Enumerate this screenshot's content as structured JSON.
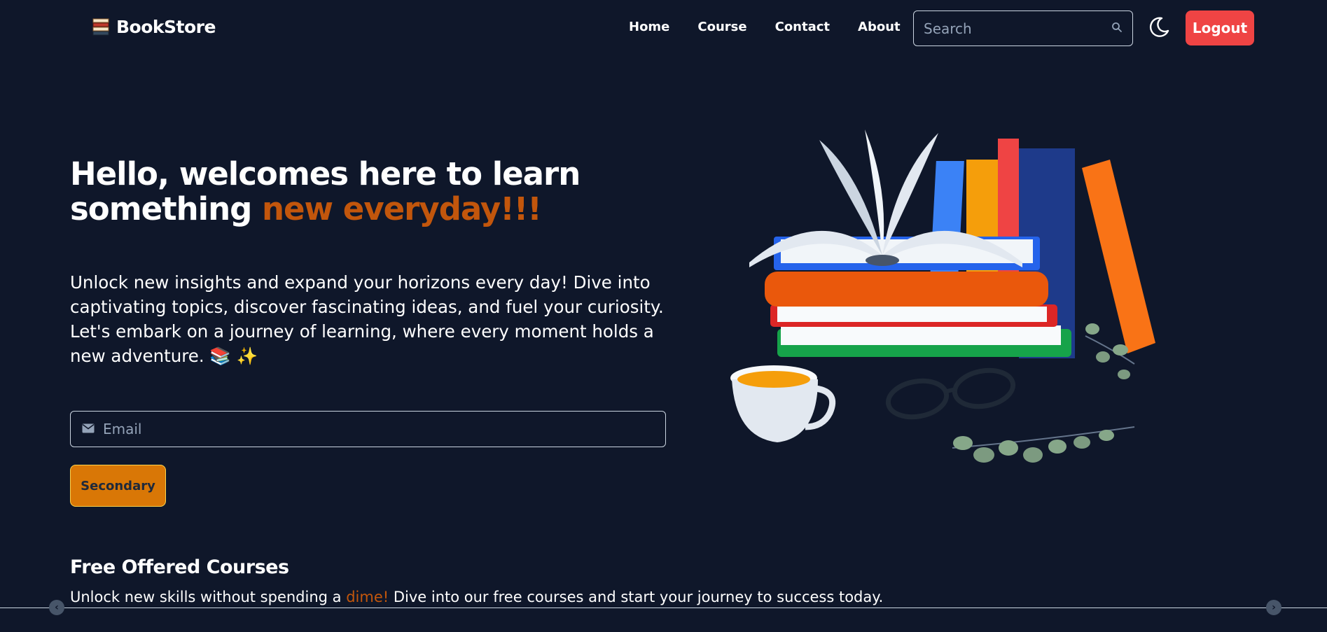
{
  "brand": {
    "name": "BookStore",
    "icon": "books-stack-icon"
  },
  "nav": {
    "links": [
      "Home",
      "Course",
      "Contact",
      "About"
    ],
    "search_placeholder": "Search",
    "search_icon": "search-icon",
    "theme_icon": "moon-icon",
    "logout_label": "Logout"
  },
  "hero": {
    "title_main": "Hello, welcomes here to learn something ",
    "title_accent": "new everyday!!!",
    "description": "Unlock new insights and expand your horizons every day! Dive into captivating topics, discover fascinating ideas, and fuel your curiosity. Let's embark on a journey of learning, where every moment holds a new adventure. 📚 ✨",
    "email_placeholder": "Email",
    "email_icon": "envelope-icon",
    "button_label": "Secondary"
  },
  "courses": {
    "title": "Free Offered Courses",
    "desc_before": "Unlock new skills without spending a ",
    "desc_accent": "dime!",
    "desc_after": " Dive into our free courses and start your journey to success today."
  },
  "colors": {
    "background": "#0f172a",
    "accent": "#c2560c",
    "logout": "#ef4444",
    "secondary_button": "#d97706"
  }
}
